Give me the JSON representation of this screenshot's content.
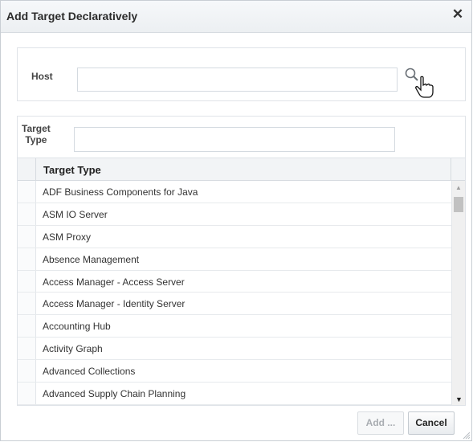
{
  "dialog": {
    "title": "Add Target Declaratively",
    "close_glyph": "✕"
  },
  "host": {
    "label": "Host",
    "value": "",
    "search_icon": "search-icon"
  },
  "filter": {
    "label_line1": "Target",
    "label_line2": "Type",
    "value": ""
  },
  "table": {
    "column": "Target Type",
    "rows": [
      "ADF Business Components for Java",
      "ASM IO Server",
      "ASM Proxy",
      "Absence Management",
      "Access Manager - Access Server",
      "Access Manager - Identity Server",
      "Accounting Hub",
      "Activity Graph",
      "Advanced Collections",
      "Advanced Supply Chain Planning"
    ],
    "scroll_position": 0.05
  },
  "buttons": {
    "add": "Add ...",
    "cancel": "Cancel"
  },
  "colors": {
    "title_bar": "#eceff2",
    "border": "#d6dbe0",
    "disabled_text": "#a9adb2"
  }
}
